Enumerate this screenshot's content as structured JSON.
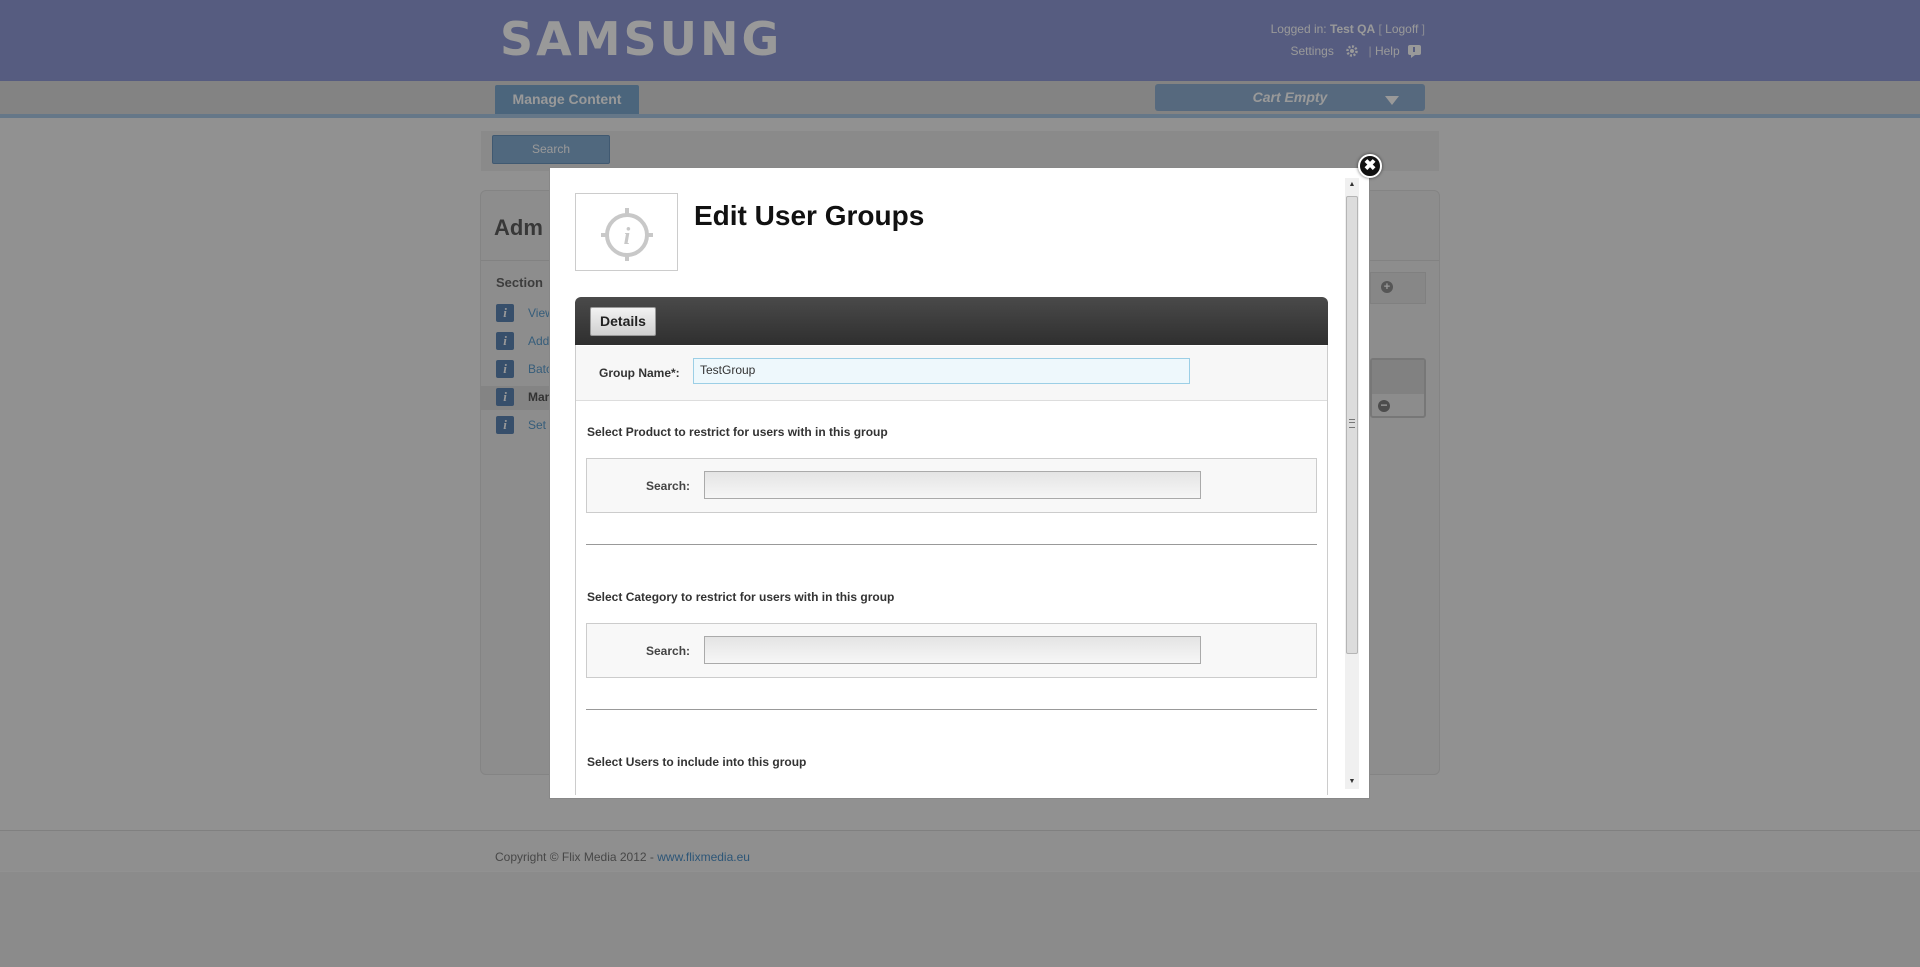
{
  "header": {
    "logo": "SAMSUNG",
    "logged_in_label": "Logged in:",
    "user_name": "Test QA",
    "logoff": "Logoff",
    "settings": "Settings",
    "help": "Help"
  },
  "nav": {
    "manage_content": "Manage Content",
    "cart": "Cart Empty"
  },
  "background": {
    "search_button": "Search",
    "admin_title": "Adm",
    "sections_label": "Section",
    "sidebar_items": [
      "View",
      "Add",
      "Batc",
      "Man",
      "Set"
    ],
    "sidebar_icon_glyph": "i"
  },
  "modal": {
    "close_glyph": "✖",
    "title": "Edit User Groups",
    "tab_details": "Details",
    "group_name_label": "Group Name*:",
    "group_name_value": "TestGroup",
    "product_section": "Select Product to restrict for users with in this group",
    "product_search_label": "Search:",
    "category_section": "Select Category to restrict for users with in this group",
    "category_search_label": "Search:",
    "users_section": "Select Users to include into this group"
  },
  "footer": {
    "copyright": "Copyright © Flix Media 2012 - ",
    "link": "www.flixmedia.eu"
  },
  "colors": {
    "header_bg": "#8f99d6",
    "accent_blue": "#7ea8cf",
    "details_header": "#333333"
  }
}
